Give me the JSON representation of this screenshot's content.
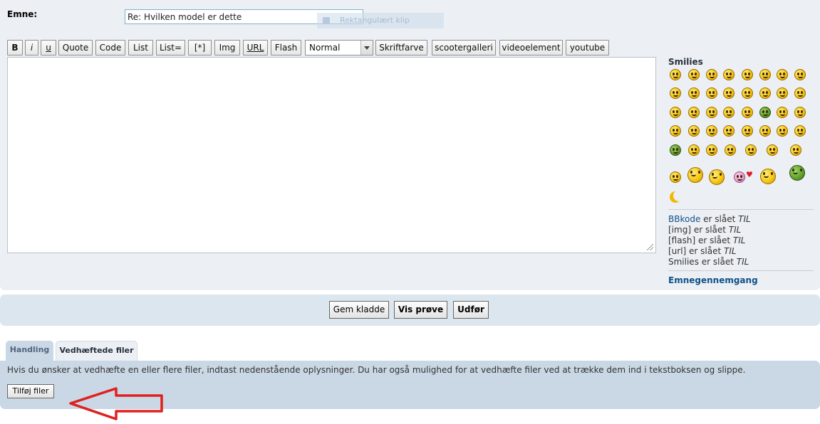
{
  "subject": {
    "label": "Emne:",
    "value": "Re: Hvilken model er dette",
    "ghost_text": "Rektangulært klip"
  },
  "toolbar": {
    "bold": "B",
    "italic": "i",
    "underline": "u",
    "quote": "Quote",
    "code": "Code",
    "list": "List",
    "list_eq": "List=",
    "list_item": "[*]",
    "img": "Img",
    "url": "URL",
    "flash": "Flash",
    "font_size": "Normal",
    "font_color": "Skriftfarve",
    "scootergalleri": "scootergalleri",
    "videoelement": "videoelement",
    "youtube": "youtube"
  },
  "smilies": {
    "heading": "Smilies"
  },
  "bbinfo": {
    "bbcode_link": "BBkode",
    "bbcode_text": " er slået ",
    "state": "TIL",
    "img_text": "[img] er slået ",
    "flash_text": "[flash] er slået ",
    "url_text": "[url] er slået ",
    "smilies_text": "Smilies er slået ",
    "overview": "Emnegennemgang"
  },
  "actions": {
    "save_draft": "Gem kladde",
    "preview": "Vis prøve",
    "submit": "Udfør"
  },
  "tabs": {
    "handling": "Handling",
    "attachments": "Vedhæftede filer"
  },
  "attachments": {
    "instructions": "Hvis du ønsker at vedhæfte en eller flere filer, indtast nedenstående oplysninger. Du har også mulighed for at vedhæfte filer ved at trække dem ind i tekstboksen og slippe.",
    "add_button": "Tilføj filer"
  }
}
